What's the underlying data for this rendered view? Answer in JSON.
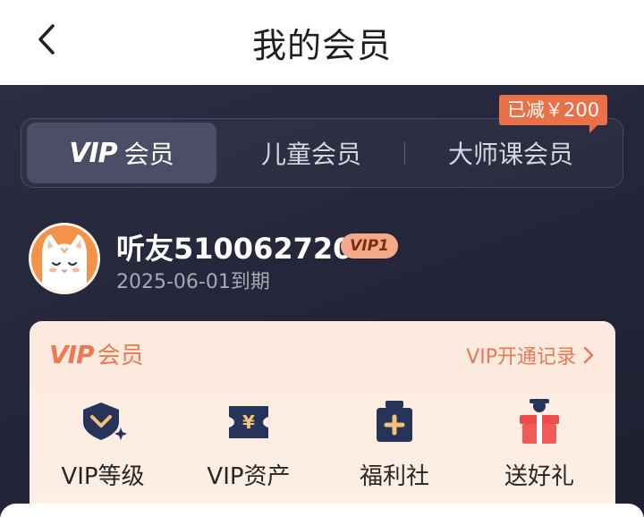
{
  "header": {
    "title": "我的会员"
  },
  "tabs": [
    {
      "vip_word": "VIP",
      "label": "会员"
    },
    {
      "label": "儿童会员"
    },
    {
      "label": "大师课会员"
    }
  ],
  "discount_badge": "已减￥200",
  "user": {
    "name": "听友510062720",
    "level_badge": "VIP1",
    "expiry": "2025-06-01到期"
  },
  "card": {
    "title_vip": "VIP",
    "title_rest": "会员",
    "records_link": "VIP开通记录",
    "features": [
      {
        "label": "VIP等级",
        "icon": "vip-level-icon"
      },
      {
        "label": "VIP资产",
        "icon": "vip-assets-icon"
      },
      {
        "label": "福利社",
        "icon": "welfare-icon"
      },
      {
        "label": "送好礼",
        "icon": "gift-icon"
      }
    ]
  },
  "colors": {
    "accent": "#e9714a",
    "card_bg": "#fde9dd",
    "dark_bg": "#25263a"
  }
}
